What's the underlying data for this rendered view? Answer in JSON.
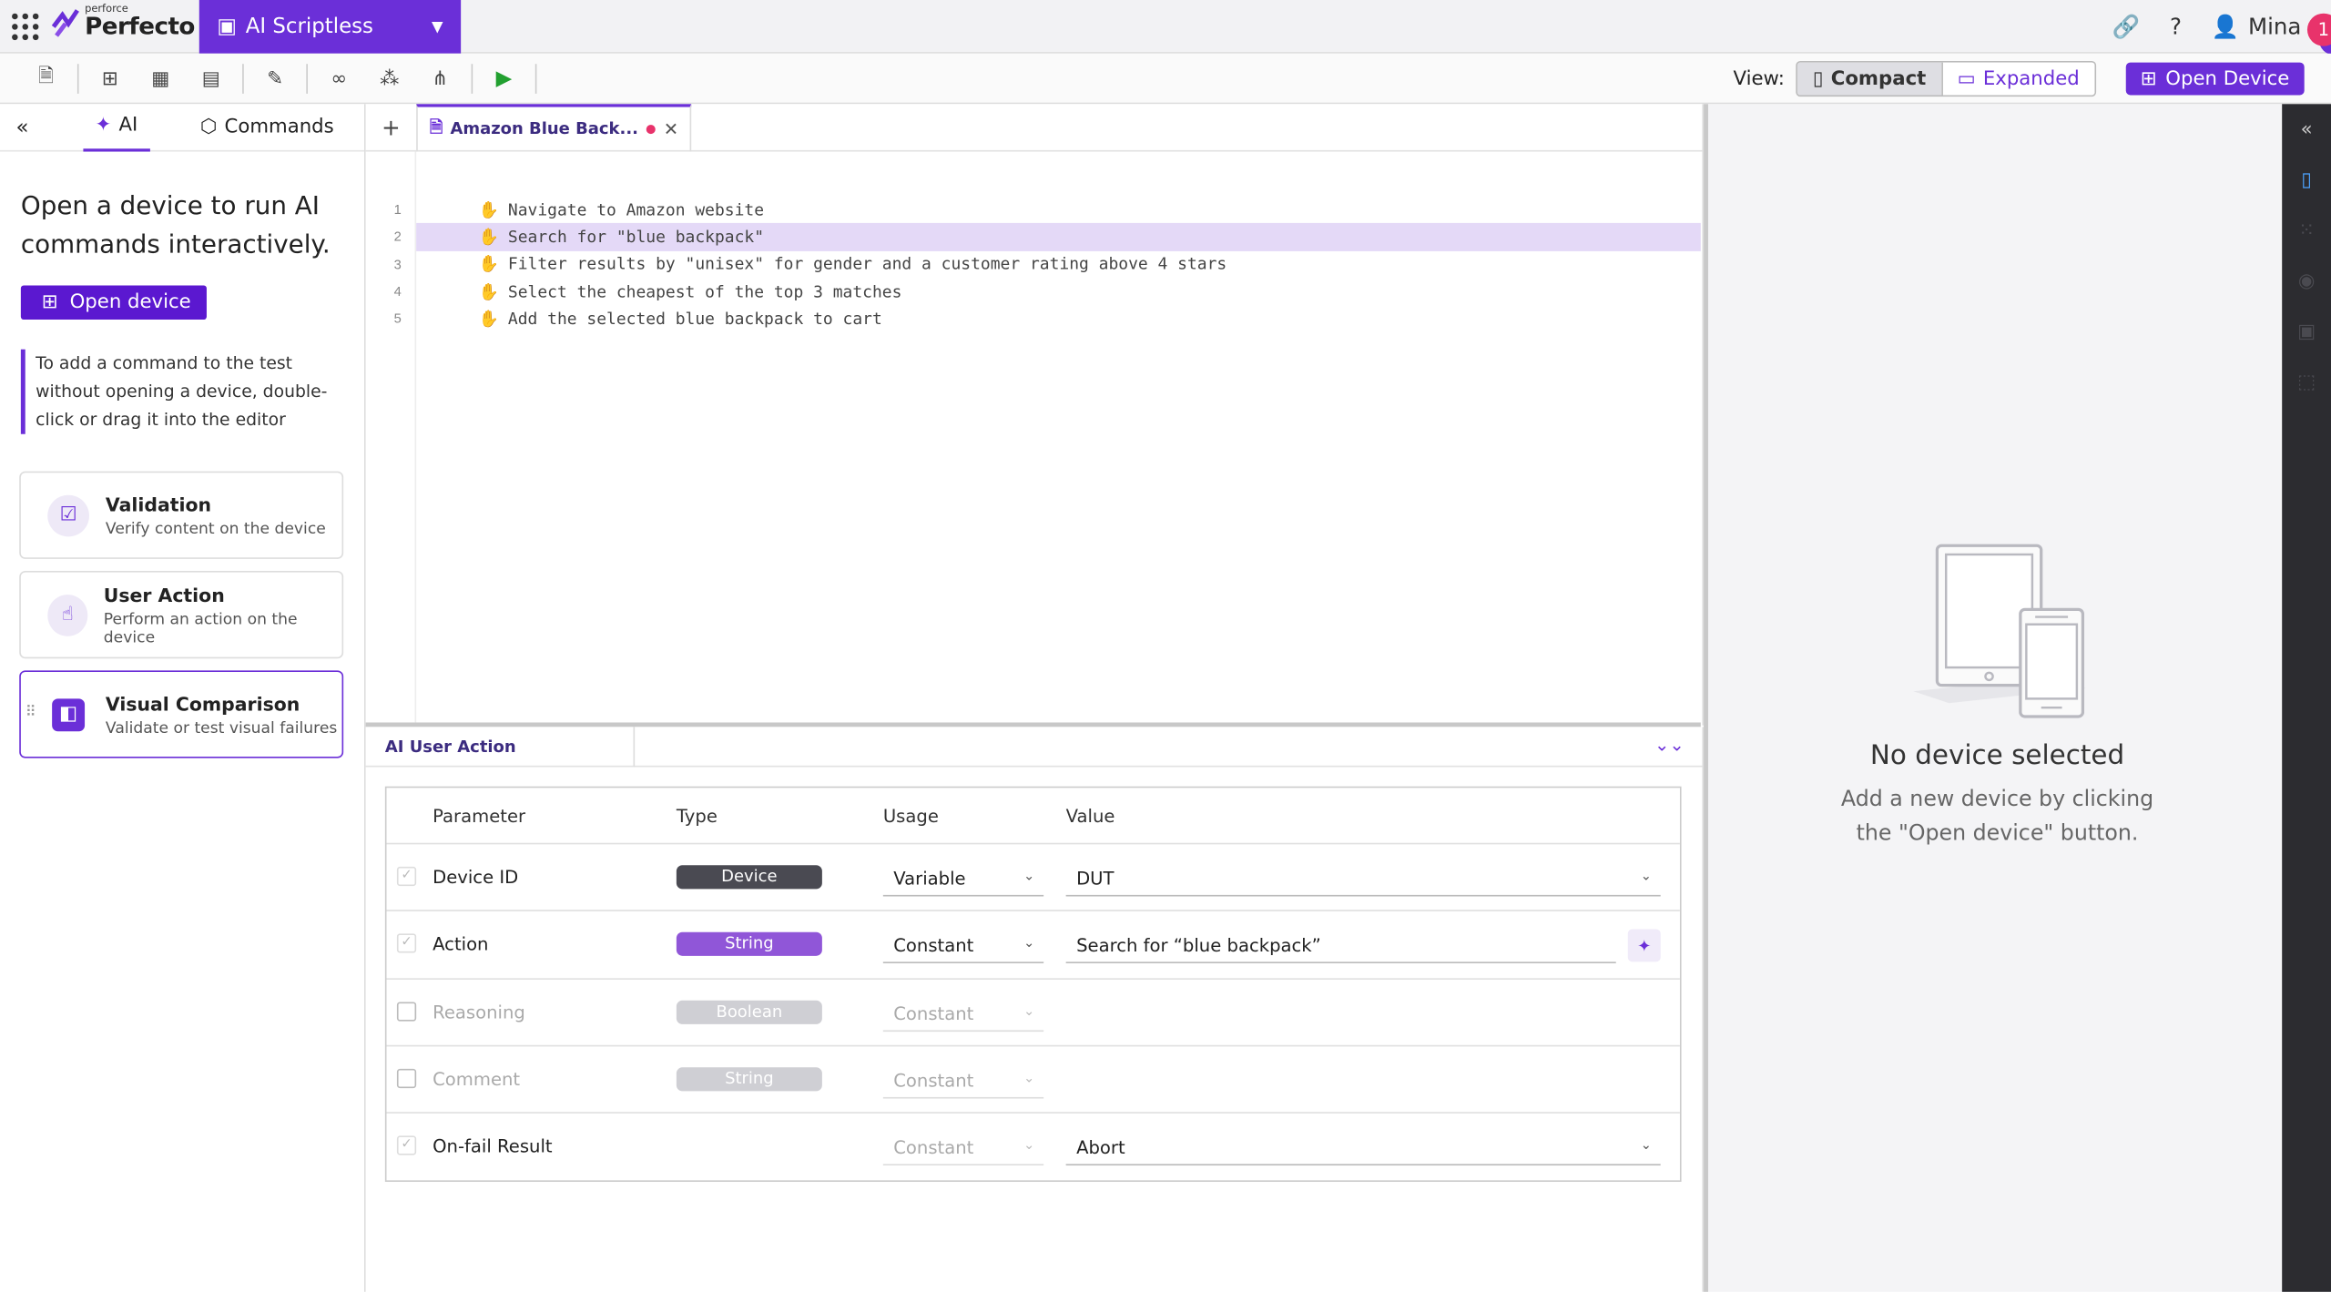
{
  "app": {
    "brand_small": "perforce",
    "brand_name": "Perfecto",
    "module": "AI Scriptless",
    "user": "Mina",
    "notification_count": "1"
  },
  "toolbar": {
    "view_label": "View:",
    "compact_label": "Compact",
    "expanded_label": "Expanded",
    "open_device_label": "Open Device",
    "active_view": "Compact"
  },
  "left_panel": {
    "tabs": [
      "AI",
      "Commands"
    ],
    "active_tab": "AI",
    "heading": "Open a device to run AI commands interactively.",
    "open_device_label": "Open device",
    "hint": "To add a command to the test without opening a device, double-click or drag it into the editor",
    "cards": [
      {
        "title": "Validation",
        "subtitle": "Verify content on the device",
        "icon": "validation-icon"
      },
      {
        "title": "User Action",
        "subtitle": "Perform an action on the device",
        "icon": "user-action-icon"
      },
      {
        "title": "Visual Comparison",
        "subtitle": "Validate or test visual failures",
        "icon": "visual-comparison-icon"
      }
    ]
  },
  "editor": {
    "tab_title": "Amazon Blue Back...",
    "lines": [
      {
        "num": "1",
        "text": "Navigate to Amazon website"
      },
      {
        "num": "2",
        "text": "Search for \"blue backpack\""
      },
      {
        "num": "3",
        "text": "Filter results by \"unisex\" for gender and a customer rating above 4 stars"
      },
      {
        "num": "4",
        "text": "Select the cheapest of the top 3 matches"
      },
      {
        "num": "5",
        "text": "Add the selected blue backpack to cart"
      }
    ],
    "selected_line": "2"
  },
  "bottom_panel": {
    "title": "AI User Action",
    "columns": [
      "Parameter",
      "Type",
      "Usage",
      "Value"
    ],
    "rows": [
      {
        "parameter": "Device ID",
        "type": "Device",
        "usage": "Variable",
        "value": "DUT",
        "type_color": "#4a4a52"
      },
      {
        "parameter": "Action",
        "type": "String",
        "usage": "Constant",
        "value": "Search for “blue backpack”",
        "type_color": "#9056d8"
      },
      {
        "parameter": "Reasoning",
        "type": "Boolean",
        "usage": "Constant",
        "value": "",
        "type_color": "#cfcfd4"
      },
      {
        "parameter": "Comment",
        "type": "String",
        "usage": "Constant",
        "value": "",
        "type_color": "#cfcfd4"
      },
      {
        "parameter": "On-fail Result",
        "type": "",
        "usage": "Constant",
        "value": "Abort",
        "type_color": ""
      }
    ]
  },
  "device_area": {
    "title": "No device selected",
    "subtitle": "Add a new device by clicking the \"Open device\" button."
  },
  "colors": {
    "accent": "#6b2fd8",
    "badge": "#e8336b"
  }
}
